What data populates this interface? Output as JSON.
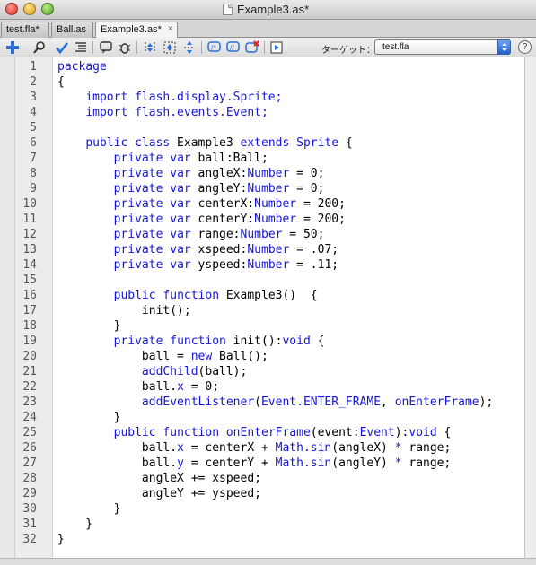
{
  "window": {
    "title": "Example3.as*"
  },
  "tabs": [
    {
      "label": "test.fla*"
    },
    {
      "label": "Ball.as"
    },
    {
      "label": "Example3.as*",
      "close": "×"
    }
  ],
  "toolbar": {
    "icons": [
      "add-statement-icon",
      "find-icon",
      "check-syntax-icon",
      "auto-format-icon",
      "code-hint-icon",
      "debug-options-icon",
      "collapse-between-braces-icon",
      "collapse-selection-icon",
      "expand-all-icon",
      "apply-block-comment-icon",
      "apply-line-comment-icon",
      "remove-comment-icon",
      "show-hide-toolbox-icon"
    ],
    "target_label": "ターゲット：",
    "target_value": "test.fla",
    "help": "?"
  },
  "editor": {
    "keyword_color": "#1515d8",
    "lines": [
      {
        "n": "1",
        "tokens": [
          {
            "t": "package",
            "k": "kw"
          }
        ]
      },
      {
        "n": "2",
        "tokens": [
          {
            "t": "{"
          }
        ]
      },
      {
        "n": "3",
        "tokens": [
          {
            "t": "    "
          },
          {
            "t": "import flash.display.Sprite;",
            "k": "kw"
          }
        ]
      },
      {
        "n": "4",
        "tokens": [
          {
            "t": "    "
          },
          {
            "t": "import flash.events.Event;",
            "k": "kw"
          }
        ]
      },
      {
        "n": "5",
        "tokens": []
      },
      {
        "n": "6",
        "tokens": [
          {
            "t": "    "
          },
          {
            "t": "public class",
            "k": "kw"
          },
          {
            "t": " Example3 "
          },
          {
            "t": "extends",
            "k": "kw"
          },
          {
            "t": " "
          },
          {
            "t": "Sprite",
            "k": "ty"
          },
          {
            "t": " {"
          }
        ]
      },
      {
        "n": "7",
        "tokens": [
          {
            "t": "        "
          },
          {
            "t": "private var",
            "k": "kw"
          },
          {
            "t": " ball:Ball;"
          }
        ]
      },
      {
        "n": "8",
        "tokens": [
          {
            "t": "        "
          },
          {
            "t": "private var",
            "k": "kw"
          },
          {
            "t": " angleX:"
          },
          {
            "t": "Number",
            "k": "ty"
          },
          {
            "t": " = 0;"
          }
        ]
      },
      {
        "n": "9",
        "tokens": [
          {
            "t": "        "
          },
          {
            "t": "private var",
            "k": "kw"
          },
          {
            "t": " angleY:"
          },
          {
            "t": "Number",
            "k": "ty"
          },
          {
            "t": " = 0;"
          }
        ]
      },
      {
        "n": "10",
        "tokens": [
          {
            "t": "        "
          },
          {
            "t": "private var",
            "k": "kw"
          },
          {
            "t": " centerX:"
          },
          {
            "t": "Number",
            "k": "ty"
          },
          {
            "t": " = 200;"
          }
        ]
      },
      {
        "n": "11",
        "tokens": [
          {
            "t": "        "
          },
          {
            "t": "private var",
            "k": "kw"
          },
          {
            "t": " centerY:"
          },
          {
            "t": "Number",
            "k": "ty"
          },
          {
            "t": " = 200;"
          }
        ]
      },
      {
        "n": "12",
        "tokens": [
          {
            "t": "        "
          },
          {
            "t": "private var",
            "k": "kw"
          },
          {
            "t": " range:"
          },
          {
            "t": "Number",
            "k": "ty"
          },
          {
            "t": " = 50;"
          }
        ]
      },
      {
        "n": "13",
        "tokens": [
          {
            "t": "        "
          },
          {
            "t": "private var",
            "k": "kw"
          },
          {
            "t": " xspeed:"
          },
          {
            "t": "Number",
            "k": "ty"
          },
          {
            "t": " = .07;"
          }
        ]
      },
      {
        "n": "14",
        "tokens": [
          {
            "t": "        "
          },
          {
            "t": "private var",
            "k": "kw"
          },
          {
            "t": " yspeed:"
          },
          {
            "t": "Number",
            "k": "ty"
          },
          {
            "t": " = .11;"
          }
        ]
      },
      {
        "n": "15",
        "tokens": []
      },
      {
        "n": "16",
        "tokens": [
          {
            "t": "        "
          },
          {
            "t": "public function",
            "k": "kw"
          },
          {
            "t": " Example3()  {"
          }
        ]
      },
      {
        "n": "17",
        "tokens": [
          {
            "t": "            init();"
          }
        ]
      },
      {
        "n": "18",
        "tokens": [
          {
            "t": "        }"
          }
        ]
      },
      {
        "n": "19",
        "tokens": [
          {
            "t": "        "
          },
          {
            "t": "private function",
            "k": "kw"
          },
          {
            "t": " init():"
          },
          {
            "t": "void",
            "k": "ty"
          },
          {
            "t": " {"
          }
        ]
      },
      {
        "n": "20",
        "tokens": [
          {
            "t": "            ball = "
          },
          {
            "t": "new",
            "k": "kw"
          },
          {
            "t": " Ball();"
          }
        ]
      },
      {
        "n": "21",
        "tokens": [
          {
            "t": "            "
          },
          {
            "t": "addChild",
            "k": "fn"
          },
          {
            "t": "(ball);"
          }
        ]
      },
      {
        "n": "22",
        "tokens": [
          {
            "t": "            ball."
          },
          {
            "t": "x",
            "k": "fn"
          },
          {
            "t": " = 0;"
          }
        ]
      },
      {
        "n": "23",
        "tokens": [
          {
            "t": "            "
          },
          {
            "t": "addEventListener",
            "k": "fn"
          },
          {
            "t": "("
          },
          {
            "t": "Event.ENTER_FRAME",
            "k": "ty"
          },
          {
            "t": ", "
          },
          {
            "t": "onEnterFrame",
            "k": "fn"
          },
          {
            "t": ");"
          }
        ]
      },
      {
        "n": "24",
        "tokens": [
          {
            "t": "        }"
          }
        ]
      },
      {
        "n": "25",
        "tokens": [
          {
            "t": "        "
          },
          {
            "t": "public function",
            "k": "kw"
          },
          {
            "t": " "
          },
          {
            "t": "onEnterFrame",
            "k": "fn"
          },
          {
            "t": "(event:"
          },
          {
            "t": "Event",
            "k": "ty"
          },
          {
            "t": "):"
          },
          {
            "t": "void",
            "k": "ty"
          },
          {
            "t": " {"
          }
        ]
      },
      {
        "n": "26",
        "tokens": [
          {
            "t": "            ball."
          },
          {
            "t": "x",
            "k": "fn"
          },
          {
            "t": " = centerX + "
          },
          {
            "t": "Math.sin",
            "k": "fn"
          },
          {
            "t": "(angleX) "
          },
          {
            "t": "*",
            "k": "kw"
          },
          {
            "t": " range;"
          }
        ]
      },
      {
        "n": "27",
        "tokens": [
          {
            "t": "            ball."
          },
          {
            "t": "y",
            "k": "fn"
          },
          {
            "t": " = centerY + "
          },
          {
            "t": "Math.sin",
            "k": "fn"
          },
          {
            "t": "(angleY) "
          },
          {
            "t": "*",
            "k": "kw"
          },
          {
            "t": " range;"
          }
        ]
      },
      {
        "n": "28",
        "tokens": [
          {
            "t": "            angleX += xspeed;"
          }
        ]
      },
      {
        "n": "29",
        "tokens": [
          {
            "t": "            angleY += yspeed;"
          }
        ]
      },
      {
        "n": "30",
        "tokens": [
          {
            "t": "        }"
          }
        ]
      },
      {
        "n": "31",
        "tokens": [
          {
            "t": "    }"
          }
        ]
      },
      {
        "n": "32",
        "tokens": [
          {
            "t": "}"
          }
        ]
      }
    ]
  }
}
